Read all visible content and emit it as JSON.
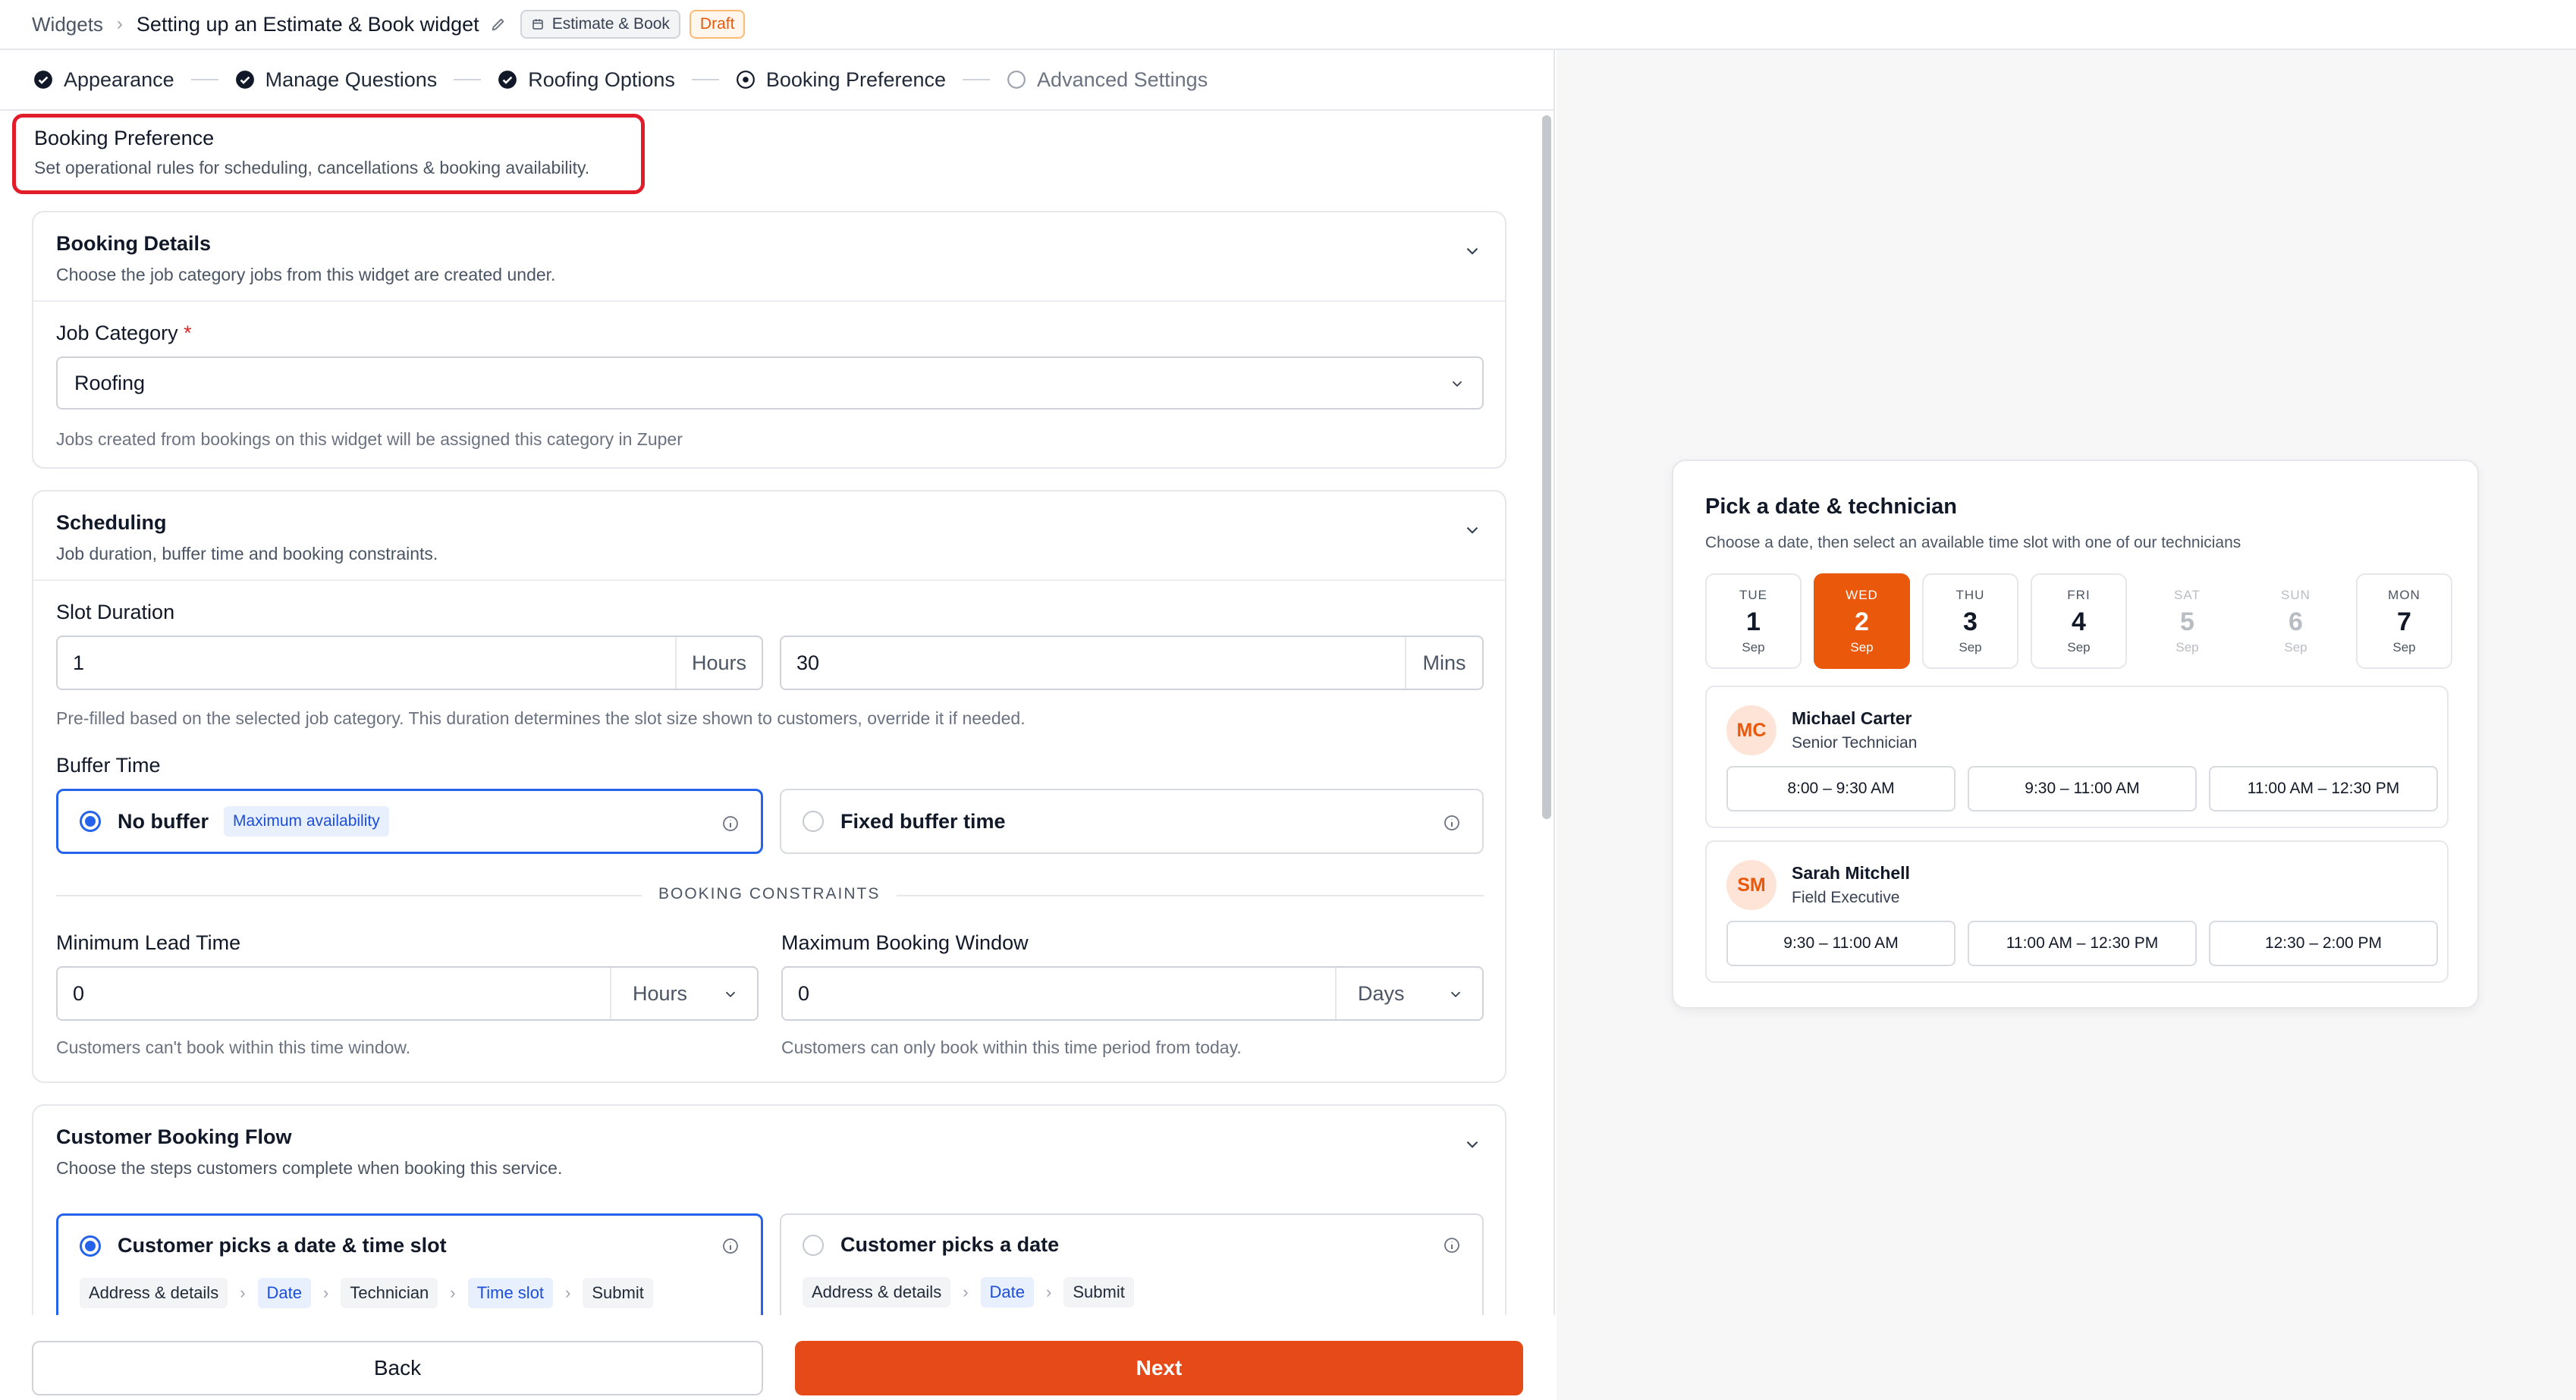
{
  "header": {
    "breadcrumb_root": "Widgets",
    "title": "Setting up an Estimate & Book widget",
    "type_chip": "Estimate & Book",
    "status_chip": "Draft"
  },
  "stepper": {
    "steps": [
      {
        "label": "Appearance",
        "state": "done"
      },
      {
        "label": "Manage Questions",
        "state": "done"
      },
      {
        "label": "Roofing Options",
        "state": "done"
      },
      {
        "label": "Booking Preference",
        "state": "current"
      },
      {
        "label": "Advanced Settings",
        "state": "pending"
      }
    ]
  },
  "page": {
    "title": "Booking Preference",
    "subtitle": "Set operational rules for scheduling, cancellations & booking availability."
  },
  "booking_details": {
    "title": "Booking Details",
    "description": "Choose the job category jobs from this widget are created under.",
    "job_category_label": "Job Category",
    "required_mark": "*",
    "job_category_value": "Roofing",
    "job_category_hint": "Jobs created from bookings on this widget will be assigned this category in Zuper"
  },
  "scheduling": {
    "title": "Scheduling",
    "description": "Job duration, buffer time and booking constraints.",
    "slot_duration_label": "Slot Duration",
    "hours_value": "1",
    "hours_unit": "Hours",
    "mins_value": "30",
    "mins_unit": "Mins",
    "slot_hint": "Pre-filled based on the selected job category. This duration determines the slot size shown to customers, override it if needed.",
    "buffer_label": "Buffer Time",
    "no_buffer_label": "No buffer",
    "no_buffer_badge": "Maximum availability",
    "fixed_buffer_label": "Fixed buffer time",
    "constraints_label": "BOOKING CONSTRAINTS",
    "min_lead_label": "Minimum Lead Time",
    "min_lead_value": "0",
    "min_lead_unit": "Hours",
    "min_lead_hint": "Customers can't book within this time window.",
    "max_window_label": "Maximum Booking Window",
    "max_window_value": "0",
    "max_window_unit": "Days",
    "max_window_hint": "Customers can only book within this time period from today."
  },
  "booking_flow": {
    "title": "Customer Booking Flow",
    "description": "Choose the steps customers complete when booking this service.",
    "option1_label": "Customer picks a date & time slot",
    "option1_steps": [
      "Address & details",
      "Date",
      "Technician",
      "Time slot",
      "Submit"
    ],
    "option2_label": "Customer picks a date",
    "option2_steps": [
      "Address & details",
      "Date",
      "Submit"
    ]
  },
  "footer": {
    "back_label": "Back",
    "next_label": "Next"
  },
  "preview": {
    "title": "Pick a date & technician",
    "subtitle": "Choose a date, then select an available time slot with one of our technicians",
    "days": [
      {
        "dow": "TUE",
        "day": "1",
        "month": "Sep",
        "state": "normal"
      },
      {
        "dow": "WED",
        "day": "2",
        "month": "Sep",
        "state": "active"
      },
      {
        "dow": "THU",
        "day": "3",
        "month": "Sep",
        "state": "normal"
      },
      {
        "dow": "FRI",
        "day": "4",
        "month": "Sep",
        "state": "normal"
      },
      {
        "dow": "SAT",
        "day": "5",
        "month": "Sep",
        "state": "disabled"
      },
      {
        "dow": "SUN",
        "day": "6",
        "month": "Sep",
        "state": "disabled"
      },
      {
        "dow": "MON",
        "day": "7",
        "month": "Sep",
        "state": "normal"
      }
    ],
    "technicians": [
      {
        "initials": "MC",
        "name": "Michael Carter",
        "role": "Senior Technician",
        "slots": [
          "8:00 – 9:30 AM",
          "9:30 – 11:00 AM",
          "11:00 AM – 12:30 PM"
        ]
      },
      {
        "initials": "SM",
        "name": "Sarah Mitchell",
        "role": "Field Executive",
        "slots": [
          "9:30 – 11:00 AM",
          "11:00 AM – 12:30 PM",
          "12:30 – 2:00 PM"
        ]
      }
    ]
  },
  "colors": {
    "accent": "#e64a19",
    "primary_blue": "#2563eb",
    "highlight_border": "#e11d2a"
  }
}
